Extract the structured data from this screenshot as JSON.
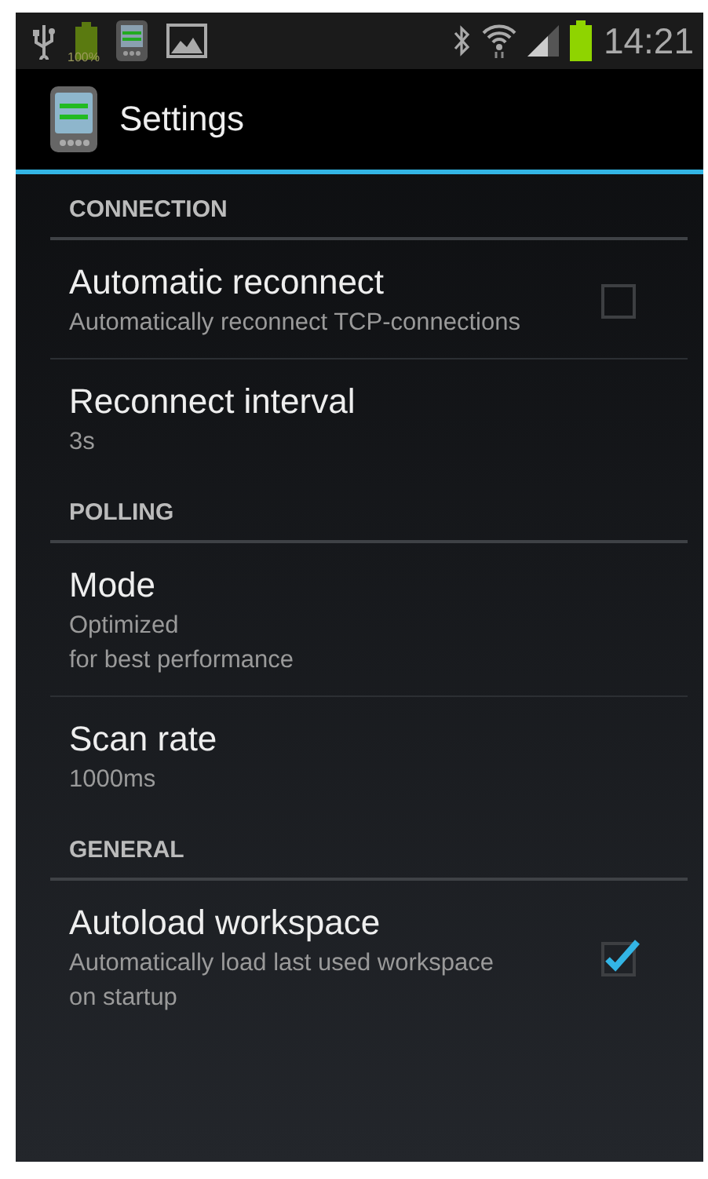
{
  "status_bar": {
    "battery_label": "100%",
    "time": "14:21"
  },
  "action_bar": {
    "title": "Settings"
  },
  "categories": [
    {
      "title": "CONNECTION",
      "items": [
        {
          "kind": "checkbox",
          "title": "Automatic reconnect",
          "summary": "Automatically reconnect TCP-connections",
          "checked": false
        },
        {
          "kind": "plain",
          "title": "Reconnect interval",
          "summary": "3s"
        }
      ]
    },
    {
      "title": "POLLING",
      "items": [
        {
          "kind": "plain",
          "title": "Mode",
          "summary": "Optimized\nfor best performance"
        },
        {
          "kind": "plain",
          "title": "Scan rate",
          "summary": "1000ms"
        }
      ]
    },
    {
      "title": "GENERAL",
      "items": [
        {
          "kind": "checkbox",
          "title": "Autoload workspace",
          "summary": "Automatically load last used workspace on startup",
          "checked": true
        }
      ]
    }
  ]
}
